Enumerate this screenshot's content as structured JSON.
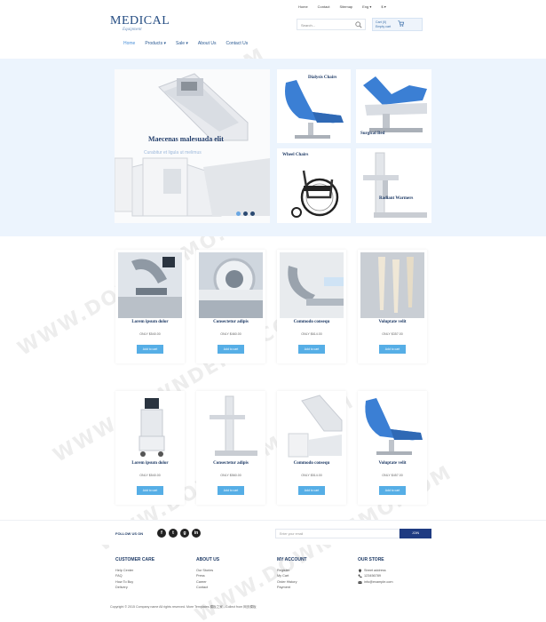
{
  "toplinks": [
    "Home",
    "Contact",
    "Sitemap",
    "Eng ▾",
    "$ ▾"
  ],
  "logo": {
    "line1": "MEDICAL",
    "line2": "Equipment"
  },
  "search": {
    "placeholder": "Search..."
  },
  "cart": {
    "line1": "Cart (0)",
    "line2": "Empty cart"
  },
  "nav": [
    {
      "label": "Home"
    },
    {
      "label": "Products",
      "caret": "▾"
    },
    {
      "label": "Sale",
      "caret": "▾"
    },
    {
      "label": "About Us"
    },
    {
      "label": "Contact Us"
    }
  ],
  "hero": {
    "title": "Maecenas malesuada elit",
    "subtitle": "Curabitur et ligula ut melimus",
    "tiles": [
      "Dialysis Chairs",
      "Surgical Bed",
      "Wheel Chairs",
      "Radiant Warmers"
    ]
  },
  "products": [
    {
      "name": "Lorem ipsum dolor",
      "price": "ONLY $540.00",
      "button": "Add to cart"
    },
    {
      "name": "Consectetur adipis",
      "price": "ONLY $460.00",
      "button": "Add to cart"
    },
    {
      "name": "Commodo consequ",
      "price": "ONLY $614.00",
      "button": "Add to cart"
    },
    {
      "name": "Voluptate velit",
      "price": "ONLY $357.00",
      "button": "Add to cart"
    },
    {
      "name": "Lorem ipsum dolor",
      "price": "ONLY $540.00",
      "button": "Add to cart"
    },
    {
      "name": "Consectetur adipis",
      "price": "ONLY $560.00",
      "button": "Add to cart"
    },
    {
      "name": "Commodo consequ",
      "price": "ONLY $514.00",
      "button": "Add to cart"
    },
    {
      "name": "Voluptate velit",
      "price": "ONLY $457.00",
      "button": "Add to cart"
    }
  ],
  "follow": {
    "label": "FOLLOW US ON",
    "icons": [
      "f",
      "t",
      "g",
      "in"
    ],
    "email_placeholder": "Enter your email",
    "join": "JOIN"
  },
  "footer": {
    "customer_care": {
      "title": "CUSTOMER CARE",
      "links": [
        "Help Center",
        "FAQ",
        "How To Buy",
        "Delivery"
      ]
    },
    "about_us": {
      "title": "ABOUT US",
      "links": [
        "Our Stories",
        "Press",
        "Career",
        "Contact"
      ]
    },
    "my_account": {
      "title": "MY ACCOUNT",
      "links": [
        "Register",
        "My Cart",
        "Order History",
        "Payment"
      ]
    },
    "our_store": {
      "title": "OUR STORE",
      "links": [
        "Street address",
        "123456789",
        "info@example.com"
      ]
    },
    "copyright": "Copyright © 2015 Company name All rights reserved. More Templates 模板之家 - Collect from 网页模板"
  },
  "watermark": "WWW.DOWNDEMO.COM",
  "colors": {
    "navy": "#1f3b66",
    "accent": "#56aee6",
    "band": "#ecf4fd"
  }
}
